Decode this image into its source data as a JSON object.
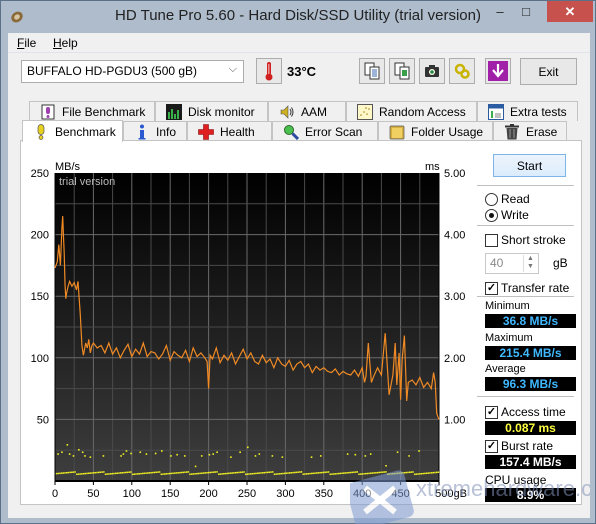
{
  "window": {
    "title": "HD Tune Pro 5.60 - Hard Disk/SSD Utility (trial version)",
    "controls": {
      "minimize": "–",
      "maximize": "□",
      "close": "✕"
    }
  },
  "menu": {
    "items": [
      {
        "label": "File",
        "accel": "F"
      },
      {
        "label": "Help",
        "accel": "H"
      }
    ]
  },
  "toolbar": {
    "drive": "BUFFALO HD-PGDU3 (500 gB)",
    "temperature": "33°C",
    "icons": [
      "copy-text-icon",
      "copy-screenshot-icon",
      "camera-icon",
      "options-icon",
      "save-download-icon"
    ],
    "exit_label": "Exit"
  },
  "tabs": {
    "top_row": [
      {
        "label": "File Benchmark",
        "icon": "file-benchmark-icon"
      },
      {
        "label": "Disk monitor",
        "icon": "disk-monitor-icon"
      },
      {
        "label": "AAM",
        "icon": "speaker-icon"
      },
      {
        "label": "Random Access",
        "icon": "random-access-icon"
      },
      {
        "label": "Extra tests",
        "icon": "extra-tests-icon"
      }
    ],
    "bottom_row": [
      {
        "label": "Benchmark",
        "icon": "exclamation-icon",
        "active": true
      },
      {
        "label": "Info",
        "icon": "info-icon"
      },
      {
        "label": "Health",
        "icon": "health-cross-icon"
      },
      {
        "label": "Error Scan",
        "icon": "magnifier-icon"
      },
      {
        "label": "Folder Usage",
        "icon": "folder-icon"
      },
      {
        "label": "Erase",
        "icon": "trash-icon"
      }
    ]
  },
  "side": {
    "start_label": "Start",
    "mode": {
      "read": "Read",
      "write": "Write",
      "selected": "write"
    },
    "short_stroke": {
      "label": "Short stroke",
      "checked": false,
      "value": "40",
      "unit": "gB"
    },
    "transfer_rate": {
      "label": "Transfer rate",
      "checked": true
    },
    "minimum": {
      "label": "Minimum",
      "value": "36.8 MB/s"
    },
    "maximum": {
      "label": "Maximum",
      "value": "215.4 MB/s"
    },
    "average": {
      "label": "Average",
      "value": "96.3 MB/s"
    },
    "access_time": {
      "label": "Access time",
      "checked": true,
      "value": "0.087 ms"
    },
    "burst_rate": {
      "label": "Burst rate",
      "checked": true,
      "value": "157.4 MB/s"
    },
    "cpu_usage": {
      "label": "CPU usage",
      "value": "8.9%"
    }
  },
  "colors": {
    "transfer_line": "#f08a24",
    "access_points": "#f0f020",
    "value_blue": "#3fb8ff",
    "value_yellow": "#ffff40",
    "value_white": "#ffffff"
  },
  "watermark": "xtremehardware.com",
  "chart_data": {
    "type": "line",
    "title": "",
    "watermark_text": "trial version",
    "xlabel": "gB",
    "ylabel_left": "MB/s",
    "ylabel_right": "ms",
    "xlim": [
      0,
      500
    ],
    "ylim_left": [
      0,
      250
    ],
    "ylim_right": [
      0,
      5
    ],
    "x_ticks": [
      "0",
      "50",
      "100",
      "150",
      "200",
      "250",
      "300",
      "350",
      "400",
      "450",
      "500gB"
    ],
    "y_ticks_left": [
      "50",
      "100",
      "150",
      "200",
      "250"
    ],
    "y_ticks_right": [
      "1.00",
      "2.00",
      "3.00",
      "4.00",
      "5.00"
    ],
    "grid": true,
    "series": [
      {
        "name": "Transfer rate (write)",
        "axis": "left",
        "unit": "MB/s",
        "x": [
          0,
          3,
          5,
          7,
          9,
          10,
          11,
          12,
          13,
          14,
          15,
          17,
          19,
          22,
          25,
          28,
          30,
          33,
          35,
          37,
          40,
          42,
          44,
          46,
          48,
          50,
          55,
          60,
          65,
          70,
          75,
          80,
          85,
          90,
          95,
          100,
          105,
          110,
          115,
          120,
          125,
          130,
          135,
          140,
          145,
          150,
          155,
          160,
          165,
          170,
          175,
          180,
          185,
          190,
          195,
          198,
          200,
          202,
          205,
          210,
          215,
          220,
          225,
          230,
          235,
          240,
          245,
          250,
          255,
          260,
          265,
          270,
          275,
          280,
          285,
          290,
          295,
          300,
          305,
          310,
          315,
          320,
          325,
          330,
          335,
          340,
          345,
          350,
          355,
          360,
          365,
          370,
          375,
          380,
          385,
          390,
          395,
          400,
          403,
          405,
          408,
          410,
          412,
          415,
          420,
          425,
          430,
          435,
          440,
          443,
          445,
          448,
          450,
          452,
          455,
          458,
          460,
          465,
          470,
          475,
          480,
          485,
          490,
          493,
          495,
          497,
          500
        ],
        "values": [
          173,
          178,
          192,
          175,
          205,
          215,
          200,
          185,
          160,
          148,
          152,
          158,
          162,
          158,
          161,
          155,
          162,
          135,
          110,
          102,
          112,
          108,
          115,
          104,
          110,
          112,
          108,
          110,
          104,
          112,
          103,
          108,
          100,
          106,
          111,
          101,
          107,
          103,
          112,
          101,
          105,
          104,
          99,
          103,
          110,
          98,
          105,
          102,
          100,
          106,
          97,
          108,
          101,
          104,
          100,
          97,
          75,
          102,
          99,
          108,
          96,
          102,
          98,
          104,
          95,
          101,
          107,
          99,
          104,
          97,
          95,
          102,
          96,
          99,
          92,
          100,
          95,
          93,
          98,
          90,
          95,
          97,
          92,
          95,
          88,
          93,
          90,
          92,
          89,
          88,
          91,
          86,
          89,
          87,
          86,
          90,
          85,
          92,
          80,
          85,
          112,
          95,
          80,
          85,
          92,
          86,
          120,
          70,
          86,
          112,
          78,
          104,
          66,
          98,
          118,
          65,
          80,
          82,
          78,
          84,
          76,
          80,
          75,
          88,
          80,
          55,
          50
        ]
      },
      {
        "name": "Access time",
        "axis": "right",
        "unit": "ms",
        "kind": "scatter",
        "baseline": 0.12,
        "outliers_x": [
          3,
          8,
          15,
          18,
          23,
          30,
          35,
          38,
          45,
          62,
          85,
          88,
          92,
          98,
          110,
          118,
          130,
          138,
          150,
          158,
          168,
          182,
          190,
          200,
          205,
          210,
          228,
          240,
          250,
          260,
          265,
          282,
          295,
          333,
          345,
          380,
          390,
          403,
          410,
          430,
          445,
          460,
          473
        ],
        "outliers_y": [
          0.45,
          0.48,
          0.6,
          0.45,
          0.42,
          0.52,
          0.48,
          0.42,
          0.4,
          0.42,
          0.42,
          0.45,
          0.5,
          0.46,
          0.48,
          0.45,
          0.46,
          0.5,
          0.42,
          0.44,
          0.42,
          0.25,
          0.42,
          0.44,
          0.45,
          0.48,
          0.4,
          0.48,
          0.56,
          0.42,
          0.45,
          0.42,
          0.4,
          0.4,
          0.42,
          0.45,
          0.44,
          0.42,
          0.45,
          0.26,
          0.48,
          0.42,
          0.5
        ]
      }
    ]
  }
}
